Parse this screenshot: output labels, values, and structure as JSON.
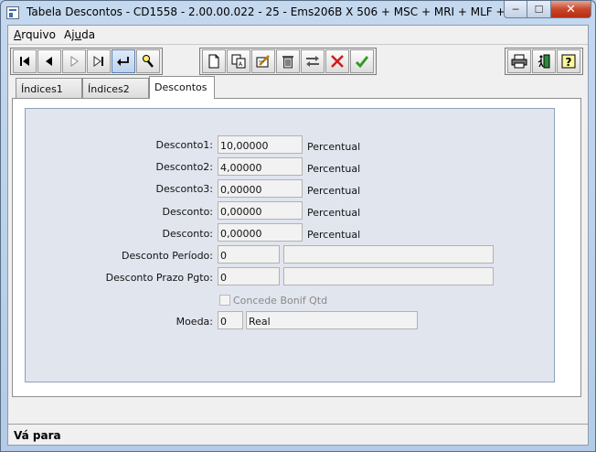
{
  "window": {
    "title": "Tabela Descontos - CD1558 - 2.00.00.022 - 25 - Ems206B X 506 + MSC + MRI + MLF + WMS",
    "buttons": {
      "minimize": "─",
      "maximize": "☐",
      "close": "✕"
    }
  },
  "menu": [
    {
      "label_pre": "",
      "accel": "A",
      "label_post": "rquivo"
    },
    {
      "label_pre": "Aj",
      "accel": "u",
      "label_post": "da"
    }
  ],
  "toolbar": {
    "nav": [
      "first-record",
      "previous-record",
      "next-record",
      "last-record",
      "go-to",
      "search"
    ],
    "edit": [
      "new",
      "copy",
      "edit",
      "delete",
      "undo",
      "cancel",
      "save"
    ],
    "right": [
      "print",
      "exit",
      "help"
    ]
  },
  "tabs": [
    {
      "label": "Índices1",
      "active": false
    },
    {
      "label": "Índices2",
      "active": false
    },
    {
      "label": "Descontos",
      "active": true
    }
  ],
  "form": {
    "desconto1": {
      "label": "Desconto1:",
      "value": "10,00000",
      "suffix": "Percentual"
    },
    "desconto2": {
      "label": "Desconto2:",
      "value": "4,00000",
      "suffix": "Percentual"
    },
    "desconto3": {
      "label": "Desconto3:",
      "value": "0,00000",
      "suffix": "Percentual"
    },
    "desconto4": {
      "label": "Desconto:",
      "value": "0,00000",
      "suffix": "Percentual"
    },
    "desconto5": {
      "label": "Desconto:",
      "value": "0,00000",
      "suffix": "Percentual"
    },
    "desconto_periodo": {
      "label": "Desconto Período:",
      "value": "0",
      "desc": ""
    },
    "desconto_prazo": {
      "label": "Desconto Prazo Pgto:",
      "value": "0",
      "desc": ""
    },
    "concede_bonif": {
      "label": "Concede Bonif Qtd",
      "checked": false,
      "enabled": false
    },
    "moeda": {
      "label": "Moeda:",
      "code": "0",
      "desc": "Real"
    }
  },
  "status": {
    "text": "Vá para"
  }
}
